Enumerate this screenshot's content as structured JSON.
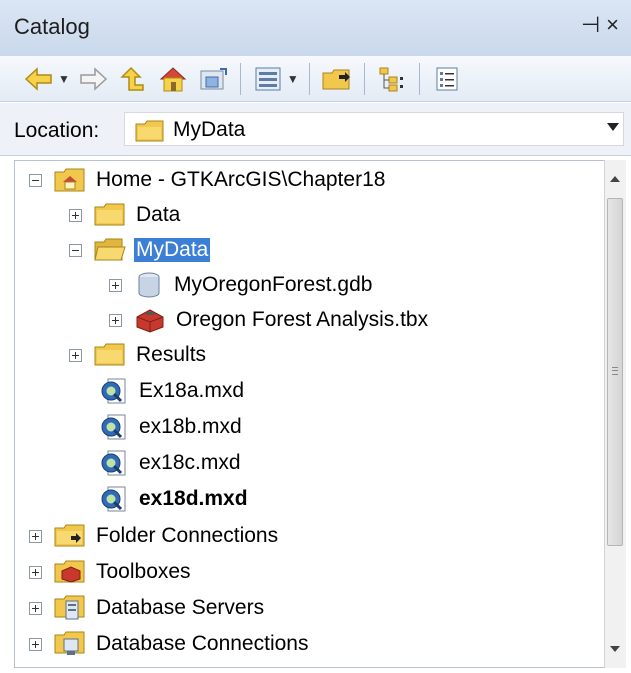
{
  "window": {
    "title": "Catalog",
    "pin_glyph": "⊣",
    "close_glyph": "×"
  },
  "toolbar": {
    "buttons": [
      {
        "icon": "back-arrow-icon"
      },
      {
        "icon": "forward-arrow-icon"
      },
      {
        "icon": "up-one-level-icon"
      },
      {
        "icon": "home-icon"
      },
      {
        "icon": "refresh-folder-icon"
      },
      {
        "icon": "view-details-icon"
      },
      {
        "icon": "connect-folder-icon"
      },
      {
        "icon": "toggle-contents-icon"
      },
      {
        "icon": "options-icon"
      }
    ]
  },
  "location": {
    "label": "Location:",
    "value": "MyData"
  },
  "tree": {
    "home": "Home - GTKArcGIS\\Chapter18",
    "data": "Data",
    "mydata": "MyData",
    "gdb": "MyOregonForest.gdb",
    "tbx": "Oregon Forest Analysis.tbx",
    "results": "Results",
    "ex18a": "Ex18a.mxd",
    "ex18b": "ex18b.mxd",
    "ex18c": "ex18c.mxd",
    "ex18d": "ex18d.mxd",
    "folder_connections": "Folder Connections",
    "toolboxes": "Toolboxes",
    "database_servers": "Database Servers",
    "database_connections": "Database Connections"
  },
  "colors": {
    "selection": "#3c7fd6",
    "folder": "#f1c84b",
    "title_bar": "#cfdcee"
  }
}
